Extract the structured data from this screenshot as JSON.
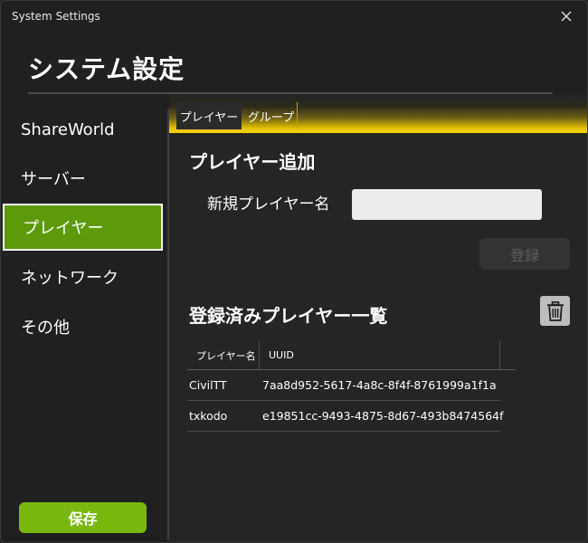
{
  "window": {
    "title": "System Settings"
  },
  "header": {
    "title": "システム設定"
  },
  "sidebar": {
    "items": [
      {
        "label": "ShareWorld",
        "active": false
      },
      {
        "label": "サーバー",
        "active": false
      },
      {
        "label": "プレイヤー",
        "active": true
      },
      {
        "label": "ネットワーク",
        "active": false
      },
      {
        "label": "その他",
        "active": false
      }
    ],
    "save_label": "保存"
  },
  "tabs": [
    {
      "label": "プレイヤー",
      "active": true
    },
    {
      "label": "グループ",
      "active": false
    }
  ],
  "add_player": {
    "heading": "プレイヤー追加",
    "name_label": "新規プレイヤー名",
    "name_value": "",
    "register_label": "登録"
  },
  "player_list": {
    "heading": "登録済みプレイヤー一覧",
    "columns": [
      "プレイヤー名",
      "UUID"
    ],
    "rows": [
      {
        "name": "CivilTT",
        "uuid": "7aa8d952-5617-4a8c-8f4f-8761999a1f1a"
      },
      {
        "name": "txkodo",
        "uuid": "e19851cc-9493-4875-8d67-493b8474564f"
      }
    ]
  },
  "colors": {
    "accent_active": "#5c9a0b",
    "save_button": "#7bb80f",
    "tab_strip": "#f6d400",
    "background": "#202020"
  },
  "icons": {
    "close": "close-icon",
    "trash": "trash-icon"
  }
}
